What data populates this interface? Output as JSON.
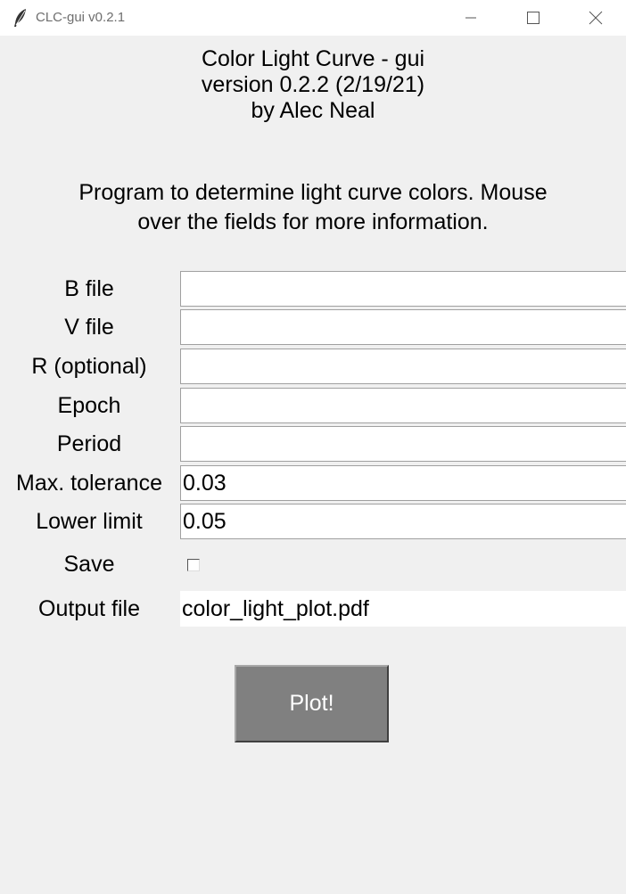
{
  "window": {
    "title": "CLC-gui v0.2.1"
  },
  "header": {
    "line1": "Color Light Curve - gui",
    "line2": "version 0.2.2 (2/19/21)",
    "line3": "by Alec Neal"
  },
  "description": {
    "line1": "Program to determine light curve colors. Mouse",
    "line2": "over the fields for more information."
  },
  "form": {
    "b_file": {
      "label": "B file",
      "value": ""
    },
    "v_file": {
      "label": "V file",
      "value": ""
    },
    "r_file": {
      "label": "R (optional)",
      "value": ""
    },
    "epoch": {
      "label": "Epoch",
      "value": ""
    },
    "period": {
      "label": "Period",
      "value": ""
    },
    "max_tolerance": {
      "label": "Max. tolerance",
      "value": "0.03"
    },
    "lower_limit": {
      "label": "Lower limit",
      "value": "0.05"
    },
    "save": {
      "label": "Save",
      "checked": false
    },
    "output_file": {
      "label": "Output file",
      "value": "color_light_plot.pdf"
    }
  },
  "plot_button": {
    "label": "Plot!"
  },
  "icons": {
    "app": "feather-icon",
    "minimize": "minimize-icon",
    "maximize": "maximize-icon",
    "close": "close-icon"
  },
  "colors": {
    "background": "#f0f0f0",
    "titlebar": "#ffffff",
    "button": "#808080",
    "button_text": "#ffffff"
  }
}
